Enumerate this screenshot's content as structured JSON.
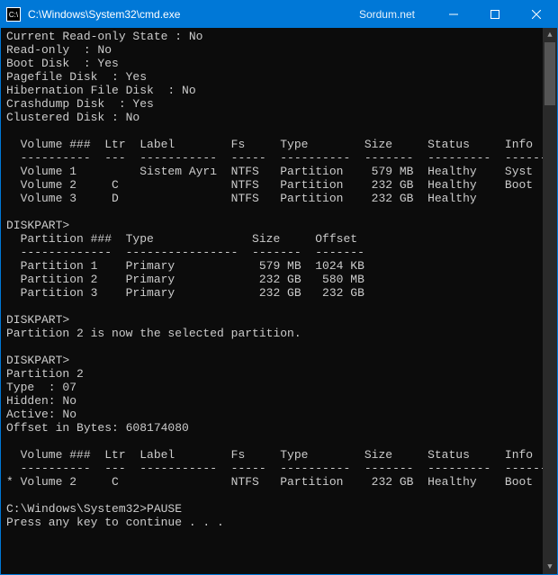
{
  "window": {
    "title": "C:\\Windows\\System32\\cmd.exe",
    "watermark": "Sordum.net",
    "icon_label": "C:\\"
  },
  "terminal_lines": [
    "Current Read-only State : No",
    "Read-only  : No",
    "Boot Disk  : Yes",
    "Pagefile Disk  : Yes",
    "Hibernation File Disk  : No",
    "Crashdump Disk  : Yes",
    "Clustered Disk : No",
    "",
    "  Volume ###  Ltr  Label        Fs     Type        Size     Status     Info",
    "  ----------  ---  -----------  -----  ----------  -------  ---------  --------",
    "  Volume 1         Sistem Ayrı  NTFS   Partition    579 MB  Healthy    Syst",
    "  Volume 2     C                NTFS   Partition    232 GB  Healthy    Boot",
    "  Volume 3     D                NTFS   Partition    232 GB  Healthy",
    "",
    "DISKPART>",
    "  Partition ###  Type              Size     Offset",
    "  -------------  ----------------  -------  -------",
    "  Partition 1    Primary            579 MB  1024 KB",
    "  Partition 2    Primary            232 GB   580 MB",
    "  Partition 3    Primary            232 GB   232 GB",
    "",
    "DISKPART>",
    "Partition 2 is now the selected partition.",
    "",
    "DISKPART>",
    "Partition 2",
    "Type  : 07",
    "Hidden: No",
    "Active: No",
    "Offset in Bytes: 608174080",
    "",
    "  Volume ###  Ltr  Label        Fs     Type        Size     Status     Info",
    "  ----------  ---  -----------  -----  ----------  -------  ---------  --------",
    "* Volume 2     C                NTFS   Partition    232 GB  Healthy    Boot",
    "",
    "C:\\Windows\\System32>PAUSE",
    "Press any key to continue . . ."
  ]
}
